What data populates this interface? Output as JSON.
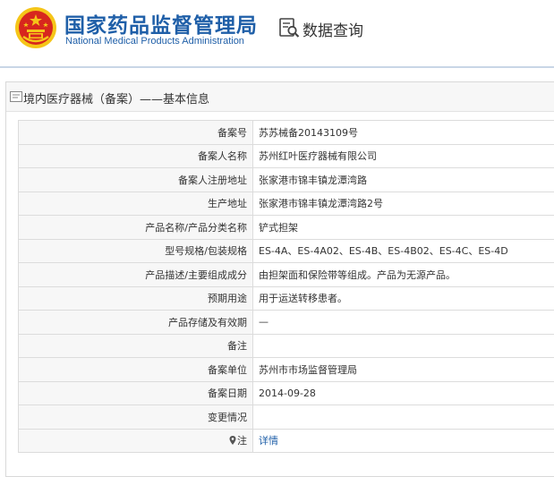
{
  "header": {
    "org_name_cn": "国家药品监督管理局",
    "org_name_en": "National Medical Products Administration",
    "query_title": "数据查询"
  },
  "panel": {
    "title": "境内医疗器械（备案）——基本信息"
  },
  "rows": [
    {
      "label": "备案号",
      "value": "苏苏械备20143109号"
    },
    {
      "label": "备案人名称",
      "value": "苏州红叶医疗器械有限公司"
    },
    {
      "label": "备案人注册地址",
      "value": "张家港市锦丰镇龙潭湾路"
    },
    {
      "label": "生产地址",
      "value": "张家港市锦丰镇龙潭湾路2号"
    },
    {
      "label": "产品名称/产品分类名称",
      "value": "铲式担架"
    },
    {
      "label": "型号规格/包装规格",
      "value": "ES-4A、ES-4A02、ES-4B、ES-4B02、ES-4C、ES-4D"
    },
    {
      "label": "产品描述/主要组成成分",
      "value": "由担架面和保险带等组成。产品为无源产品。"
    },
    {
      "label": "预期用途",
      "value": "用于运送转移患者。"
    },
    {
      "label": "产品存储及有效期",
      "value": "—"
    },
    {
      "label": "备注",
      "value": ""
    },
    {
      "label": "备案单位",
      "value": "苏州市市场监督管理局"
    },
    {
      "label": "备案日期",
      "value": "2014-09-28"
    },
    {
      "label": "变更情况",
      "value": ""
    },
    {
      "label": "注",
      "value": "详情"
    }
  ],
  "colors": {
    "brand_blue": "#1f5fa8",
    "emblem_red": "#d7261e",
    "emblem_gold": "#f5c518"
  }
}
